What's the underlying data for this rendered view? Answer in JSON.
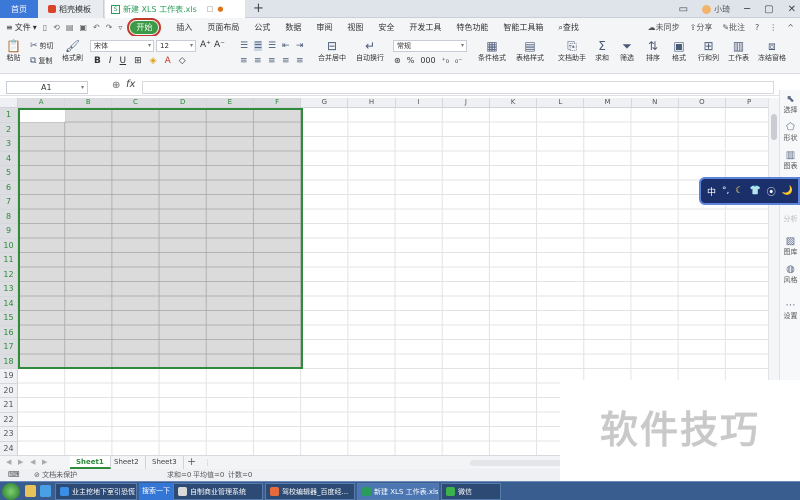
{
  "titlebar": {
    "home_tab": "首页",
    "doc_tab": "稻壳模板",
    "file_tab": "新建 XLS 工作表.xls",
    "file_tab_small": "□",
    "file_tab_close": "●",
    "add_tab": "+",
    "user": "小琦",
    "window_controls": [
      "▭",
      "─",
      "▢",
      "✕"
    ]
  },
  "menubar": {
    "file": "文件",
    "file_caret": "▾",
    "quick_access": [
      "▯",
      "⟲",
      "▤",
      "▣",
      "↶",
      "↷",
      "▿"
    ],
    "items": [
      "开始",
      "插入",
      "页面布局",
      "公式",
      "数据",
      "审阅",
      "视图",
      "安全",
      "开发工具",
      "特色功能",
      "智能工具箱"
    ],
    "active_item": "开始",
    "search": "查找",
    "sync": "未同步",
    "share": "分享",
    "comment": "批注",
    "help": "?",
    "more": "⋮",
    "collapse": "^"
  },
  "ribbon": {
    "paste": "粘贴",
    "cut": "剪切",
    "copy": "复制",
    "format_painter": "格式刷",
    "font_name": "宋体",
    "font_size": "12",
    "grow_font": "A⁺",
    "shrink_font": "A⁻",
    "bold": "B",
    "italic": "I",
    "underline": "U",
    "merge_center": "合并居中",
    "wrap_text": "自动换行",
    "number_format": "常规",
    "percent": "%",
    "thousands": "000",
    "conditional_format": "条件格式",
    "table_style": "表格样式",
    "doc_helper": "文档助手",
    "sum": "求和",
    "filter": "筛选",
    "sort": "排序",
    "format": "格式",
    "row_col": "行和列",
    "worksheet": "工作表",
    "freeze": "冻结窗格"
  },
  "formulabar": {
    "cell_ref": "A1",
    "zoom_icon": "⊕",
    "fx": "fx",
    "formula": ""
  },
  "grid": {
    "columns": [
      "A",
      "B",
      "C",
      "D",
      "E",
      "F",
      "G",
      "H",
      "I",
      "J",
      "K",
      "L",
      "M",
      "N",
      "O",
      "P"
    ],
    "rows": [
      "1",
      "2",
      "3",
      "4",
      "5",
      "6",
      "7",
      "8",
      "9",
      "10",
      "11",
      "12",
      "13",
      "14",
      "15",
      "16",
      "17",
      "18",
      "19",
      "20",
      "21",
      "22",
      "23",
      "24"
    ],
    "selection": "A1:F18",
    "active_cell": "A1"
  },
  "sidepanel": {
    "items": [
      "选择",
      "形状",
      "图表",
      "分析",
      "图库",
      "风格",
      "设置"
    ]
  },
  "ime": {
    "items": [
      "中",
      "°,",
      "☾",
      "👕",
      "⦿",
      "🌙"
    ]
  },
  "sheets": {
    "tabs": [
      "Sheet1",
      "Sheet2",
      "Sheet3"
    ],
    "active": "Sheet1",
    "add": "+",
    "nav": [
      "◀",
      "▶",
      "◀",
      "▶"
    ]
  },
  "status": {
    "protection": "文档未保护",
    "sum": "求和=0",
    "average": "平均值=0",
    "count": "计数=0"
  },
  "taskbar": {
    "items": [
      "业主挖地下室引恐慌",
      "搜索一下",
      "自制商业管理系统",
      "驾校编辑器_百度经...",
      "新建 XLS 工作表.xls ...",
      "微信"
    ]
  },
  "watermark": "软件技巧",
  "colors": {
    "accent_green": "#2f8a3b",
    "active_menu": "#3a9a45",
    "active_menu_outline": "#c0392b",
    "home_tab": "#3c78d8",
    "selection_fill": "#bebebe",
    "taskbar": "#3a5d8f"
  }
}
